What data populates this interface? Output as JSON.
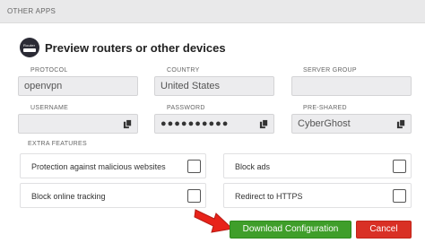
{
  "section": {
    "title": "OTHER APPS"
  },
  "card": {
    "title": "Preview routers or other devices",
    "icon_label": "Router"
  },
  "fields": {
    "protocol": {
      "label": "PROTOCOL",
      "value": "openvpn"
    },
    "country": {
      "label": "COUNTRY",
      "value": "United States"
    },
    "server_group": {
      "label": "SERVER GROUP",
      "value": ""
    },
    "username": {
      "label": "USERNAME",
      "value": ""
    },
    "password": {
      "label": "PASSWORD",
      "value": "●●●●●●●●●●"
    },
    "pre_shared": {
      "label": "PRE-SHARED",
      "value": "CyberGhost"
    }
  },
  "extra_features": {
    "label": "EXTRA FEATURES",
    "items": [
      {
        "label": "Protection against malicious websites",
        "checked": false
      },
      {
        "label": "Block ads",
        "checked": false
      },
      {
        "label": "Block online tracking",
        "checked": false
      },
      {
        "label": "Redirect to HTTPS",
        "checked": false
      }
    ]
  },
  "actions": {
    "download_label": "Download Configuration",
    "cancel_label": "Cancel"
  },
  "colors": {
    "download": "#3f9e2a",
    "cancel": "#d93025",
    "arrow": "#e8231a",
    "header_bg": "#e9e9ea"
  },
  "icons": {
    "copy": "copy-icon",
    "router": "router-icon",
    "arrow": "arrow-right-icon"
  }
}
